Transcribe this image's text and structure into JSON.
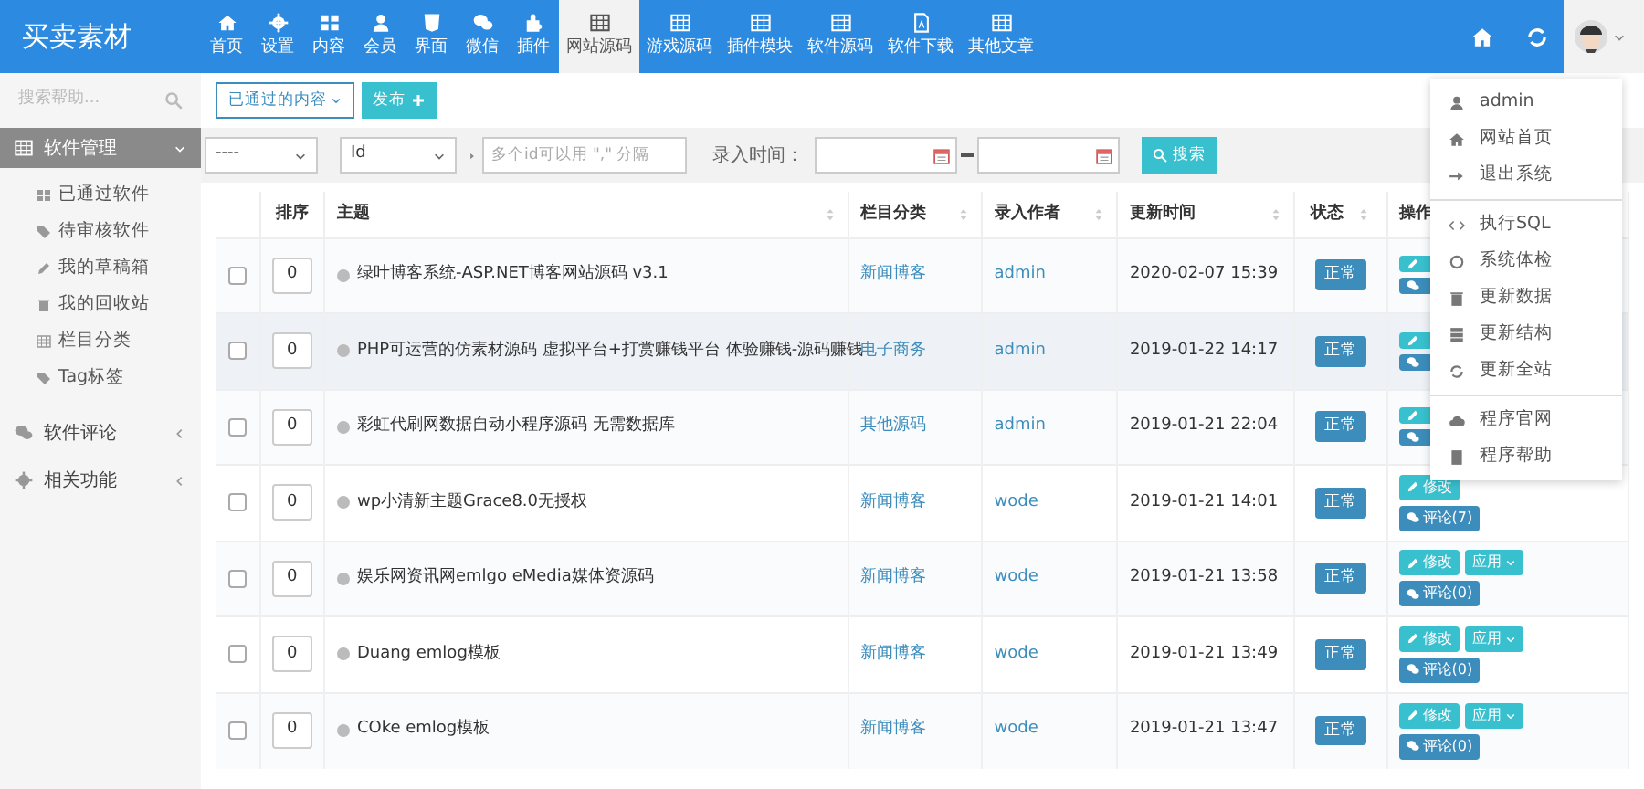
{
  "app": {
    "title": "买卖素材"
  },
  "nav": [
    {
      "label": "首页",
      "selected": false
    },
    {
      "label": "设置",
      "selected": false
    },
    {
      "label": "内容",
      "selected": false
    },
    {
      "label": "会员",
      "selected": false
    },
    {
      "label": "界面",
      "selected": false
    },
    {
      "label": "微信",
      "selected": false
    },
    {
      "label": "插件",
      "selected": false
    },
    {
      "label": "网站源码",
      "selected": true
    },
    {
      "label": "游戏源码",
      "selected": false
    },
    {
      "label": "插件模块",
      "selected": false
    },
    {
      "label": "软件源码",
      "selected": false
    },
    {
      "label": "软件下载",
      "selected": false
    },
    {
      "label": "其他文章",
      "selected": false
    }
  ],
  "user_menu": {
    "open": true,
    "groups": [
      [
        {
          "label": "admin"
        },
        {
          "label": "网站首页"
        },
        {
          "label": "退出系统"
        }
      ],
      [
        {
          "label": "执行SQL"
        },
        {
          "label": "系统体检"
        },
        {
          "label": "更新数据"
        },
        {
          "label": "更新结构"
        },
        {
          "label": "更新全站"
        }
      ],
      [
        {
          "label": "程序官网"
        },
        {
          "label": "程序帮助"
        }
      ]
    ]
  },
  "sidebar": {
    "search": {
      "placeholder": "搜索帮助..."
    },
    "sections": [
      {
        "label": "软件管理",
        "selected": true,
        "expanded": true,
        "children": [
          {
            "label": "已通过软件"
          },
          {
            "label": "待审核软件"
          },
          {
            "label": "我的草稿箱"
          },
          {
            "label": "我的回收站"
          },
          {
            "label": "栏目分类"
          },
          {
            "label": "Tag标签"
          }
        ]
      },
      {
        "label": "软件评论",
        "selected": false,
        "expanded": false
      },
      {
        "label": "相关功能",
        "selected": false,
        "expanded": false
      }
    ]
  },
  "content_filter": {
    "label": "已通过的内容"
  },
  "publish_button": {
    "label": "发布"
  },
  "filters": {
    "category_select": {
      "value": "----"
    },
    "field_select": {
      "value": "Id"
    },
    "ids_field": {
      "placeholder": "多个id可以用 \",\" 分隔"
    },
    "date_label": "录入时间：",
    "search_button": {
      "label": "搜索"
    }
  },
  "table": {
    "columns": [
      {
        "label": "排序",
        "sortable": false
      },
      {
        "label": "主题",
        "sortable": true
      },
      {
        "label": "栏目分类",
        "sortable": true
      },
      {
        "label": "录入作者",
        "sortable": true
      },
      {
        "label": "更新时间",
        "sortable": true
      },
      {
        "label": "状态",
        "sortable": true
      },
      {
        "label": "操作",
        "sortable": false
      }
    ],
    "rows": [
      {
        "checked": false,
        "highlighted": false,
        "order": "0",
        "title": "绿叶博客系统-ASP.NET博客网站源码 v3.1",
        "category": "新闻博客",
        "author": "admin",
        "updated": "2020-02-07 15:39",
        "status": "正常",
        "actions": [
          {
            "kind": "edit"
          },
          {
            "kind": "comment"
          }
        ]
      },
      {
        "checked": false,
        "highlighted": true,
        "order": "0",
        "title": "PHP可运营的仿素材源码 虚拟平台+打赏赚钱平台 体验赚钱-源码赚钱",
        "category": "电子商务",
        "author": "admin",
        "updated": "2019-01-22 14:17",
        "status": "正常",
        "actions": [
          {
            "kind": "edit"
          },
          {
            "kind": "comment"
          }
        ]
      },
      {
        "checked": false,
        "highlighted": false,
        "order": "0",
        "title": "彩虹代刷网数据自动小程序源码 无需数据库",
        "category": "其他源码",
        "author": "admin",
        "updated": "2019-01-21 22:04",
        "status": "正常",
        "actions": [
          {
            "kind": "edit"
          },
          {
            "kind": "comment"
          }
        ]
      },
      {
        "checked": false,
        "highlighted": false,
        "order": "0",
        "title": "wp小清新主题Grace8.0无授权",
        "category": "新闻博客",
        "author": "wode",
        "updated": "2019-01-21 14:01",
        "status": "正常",
        "actions": [
          {
            "kind": "edit",
            "label": "修改"
          },
          {
            "kind": "comment",
            "label": "评论(7)"
          }
        ]
      },
      {
        "checked": false,
        "highlighted": false,
        "order": "0",
        "title": "娱乐网资讯网emlgo eMedia媒体资源码",
        "category": "新闻博客",
        "author": "wode",
        "updated": "2019-01-21 13:58",
        "status": "正常",
        "actions": [
          {
            "kind": "edit",
            "label": "修改"
          },
          {
            "kind": "apply",
            "label": "应用"
          },
          {
            "kind": "comment",
            "label": "评论(0)"
          }
        ]
      },
      {
        "checked": false,
        "highlighted": false,
        "order": "0",
        "title": "Duang emlog模板",
        "category": "新闻博客",
        "author": "wode",
        "updated": "2019-01-21 13:49",
        "status": "正常",
        "actions": [
          {
            "kind": "edit",
            "label": "修改"
          },
          {
            "kind": "apply",
            "label": "应用"
          },
          {
            "kind": "comment",
            "label": "评论(0)"
          }
        ]
      },
      {
        "checked": false,
        "highlighted": false,
        "order": "0",
        "title": "COke emlog模板",
        "category": "新闻博客",
        "author": "wode",
        "updated": "2019-01-21 13:47",
        "status": "正常",
        "actions": [
          {
            "kind": "edit",
            "label": "修改"
          },
          {
            "kind": "apply",
            "label": "应用"
          },
          {
            "kind": "comment",
            "label": "评论(0)"
          }
        ]
      }
    ]
  }
}
